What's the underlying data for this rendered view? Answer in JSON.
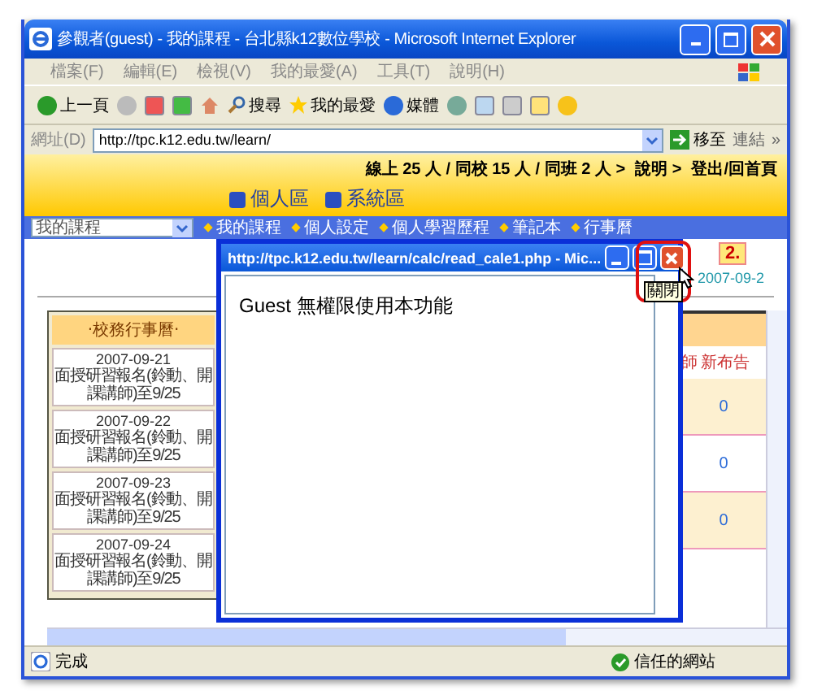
{
  "window": {
    "title": "參觀者(guest) - 我的課程 - 台北縣k12數位學校 - Microsoft Internet Explorer"
  },
  "menu": [
    "檔案(F)",
    "編輯(E)",
    "檢視(V)",
    "我的最愛(A)",
    "工具(T)",
    "說明(H)"
  ],
  "toolbar": {
    "back": "上一頁",
    "search": "搜尋",
    "favorites": "我的最愛",
    "media": "媒體"
  },
  "address": {
    "label": "網址(D)",
    "value": "http://tpc.k12.edu.tw/learn/",
    "go": "移至",
    "links": "連結",
    "more": "»"
  },
  "header": {
    "stats": "線上 25 人 / 同校 15 人 / 同班 2 人 >",
    "help": "說明 >",
    "logout": "登出/回首頁",
    "zones": [
      "個人區",
      "系統區"
    ]
  },
  "nav": {
    "select": "我的課程",
    "links": [
      "我的課程",
      "個人設定",
      "個人學習歷程",
      "筆記本",
      "行事曆"
    ]
  },
  "date_fragment": "2007-09-2",
  "calendar": {
    "title": "‧校務行事曆‧",
    "entries": [
      {
        "date": "2007-09-21",
        "text": "面授研習報名(鈴動、開課講師)至9/25"
      },
      {
        "date": "2007-09-22",
        "text": "面授研習報名(鈴動、開課講師)至9/25"
      },
      {
        "date": "2007-09-23",
        "text": "面授研習報名(鈴動、開課講師)至9/25"
      },
      {
        "date": "2007-09-24",
        "text": "面授研習報名(鈴動、開課講師)至9/25"
      }
    ]
  },
  "table": {
    "columns": [
      "師",
      "新布告"
    ],
    "cells": [
      "0",
      "0",
      "0"
    ]
  },
  "popup": {
    "title": "http://tpc.k12.edu.tw/learn/calc/read_cale1.php - Mic...",
    "message": "Guest 無權限使用本功能"
  },
  "annotation": {
    "step": "2.",
    "tooltip": "關閉"
  },
  "status": {
    "text": "完成",
    "zone": "信任的網站"
  }
}
